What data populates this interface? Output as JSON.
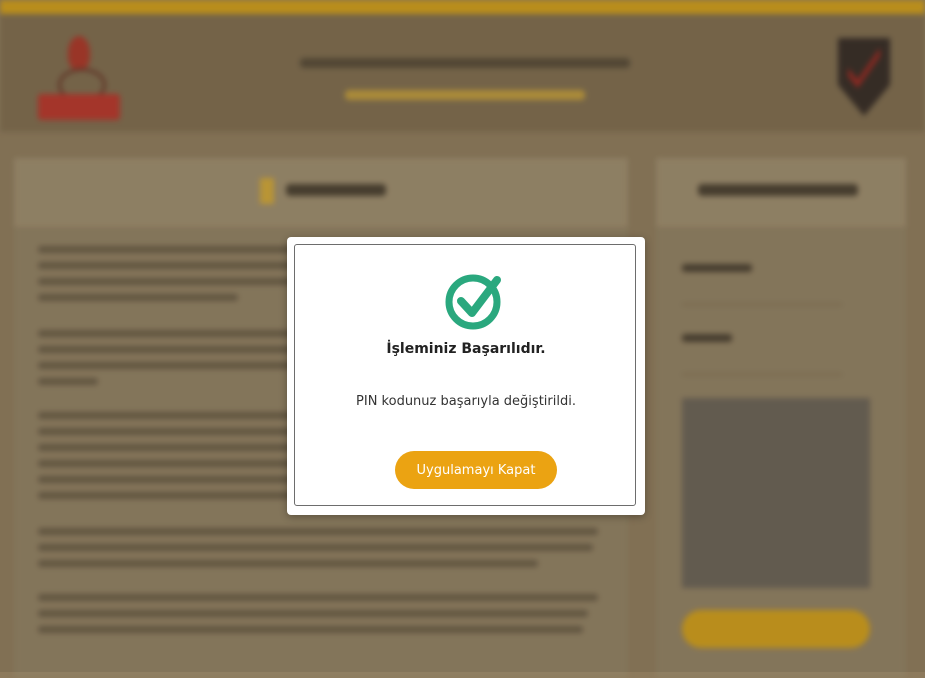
{
  "modal": {
    "title": "İşleminiz Başarılıdır.",
    "message": "PIN kodunuz başarıyla değiştirildi.",
    "close_label": "Uygulamayı Kapat",
    "icon": "check-circle-icon",
    "accent_color": "#eba312",
    "check_color": "#2aa87e"
  },
  "background": {
    "topbar_color": "#c99a1f"
  }
}
